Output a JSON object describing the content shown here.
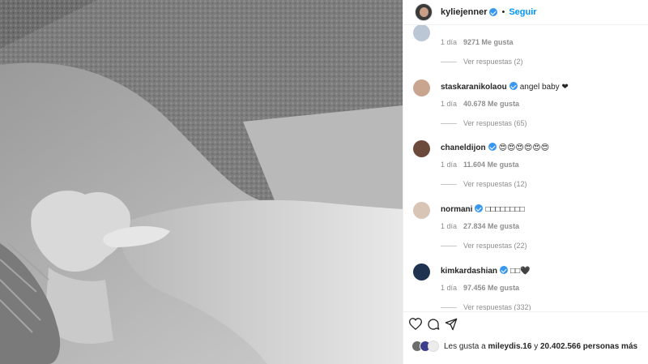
{
  "header": {
    "username": "kyliejenner",
    "follow_label": "Seguir",
    "separator": "•"
  },
  "comments": [
    {
      "username": "",
      "text": "",
      "time": "1 día",
      "likes": "9271 Me gusta",
      "replies": "Ver respuestas (2)",
      "avatar_color": "#bcc7d6"
    },
    {
      "username": "staskaranikolaou",
      "text": "angel baby ❤",
      "time": "1 día",
      "likes": "40.678 Me gusta",
      "replies": "Ver respuestas (65)",
      "avatar_color": "#c9a48e"
    },
    {
      "username": "chaneldijon",
      "text": "😍😍😍😍😍😍",
      "time": "1 día",
      "likes": "11.604 Me gusta",
      "replies": "Ver respuestas (12)",
      "avatar_color": "#6b4a3c"
    },
    {
      "username": "normani",
      "text": "□□□□□□□□",
      "time": "1 día",
      "likes": "27.834 Me gusta",
      "replies": "Ver respuestas (22)",
      "avatar_color": "#d9c5b5"
    },
    {
      "username": "kimkardashian",
      "text": "□□🖤",
      "time": "1 día",
      "likes": "97.456 Me gusta",
      "replies": "Ver respuestas (332)",
      "avatar_color": "#1f3350"
    }
  ],
  "actions": {
    "like_icon": "heart-icon",
    "comment_icon": "comment-icon",
    "share_icon": "share-icon"
  },
  "likes": {
    "prefix": "Les gusta a",
    "user": "mileydis.16",
    "middle": "y",
    "count": "20.402.566 personas más",
    "avatar_colors": [
      "#6d6d6d",
      "#3b3e8c",
      "#ececec"
    ]
  },
  "colors": {
    "accent": "#0095f6",
    "verified": "#3897f0",
    "muted": "#8e8e8e"
  }
}
